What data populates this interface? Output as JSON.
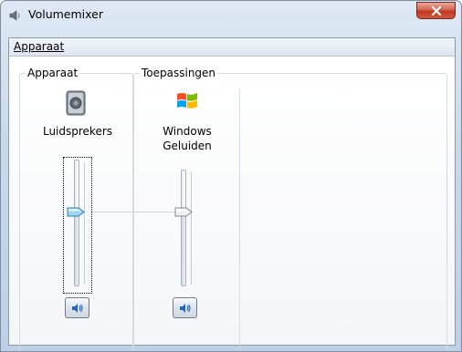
{
  "window": {
    "title": "Volumemixer"
  },
  "menu": {
    "items": [
      {
        "label": "Apparaat"
      }
    ]
  },
  "groups": {
    "device": {
      "label": "Apparaat"
    },
    "apps": {
      "label": "Toepassingen"
    }
  },
  "channels": [
    {
      "name": "Luidsprekers",
      "icon": "speaker-icon",
      "volume_fraction": 0.58,
      "muted": false
    },
    {
      "name_line1": "Windows",
      "name_line2": "Geluiden",
      "icon": "windows-logo-icon",
      "volume_fraction": 0.58,
      "muted": false
    }
  ],
  "colors": {
    "accent": "#3b8fd4",
    "title_close": "#c2371f"
  }
}
